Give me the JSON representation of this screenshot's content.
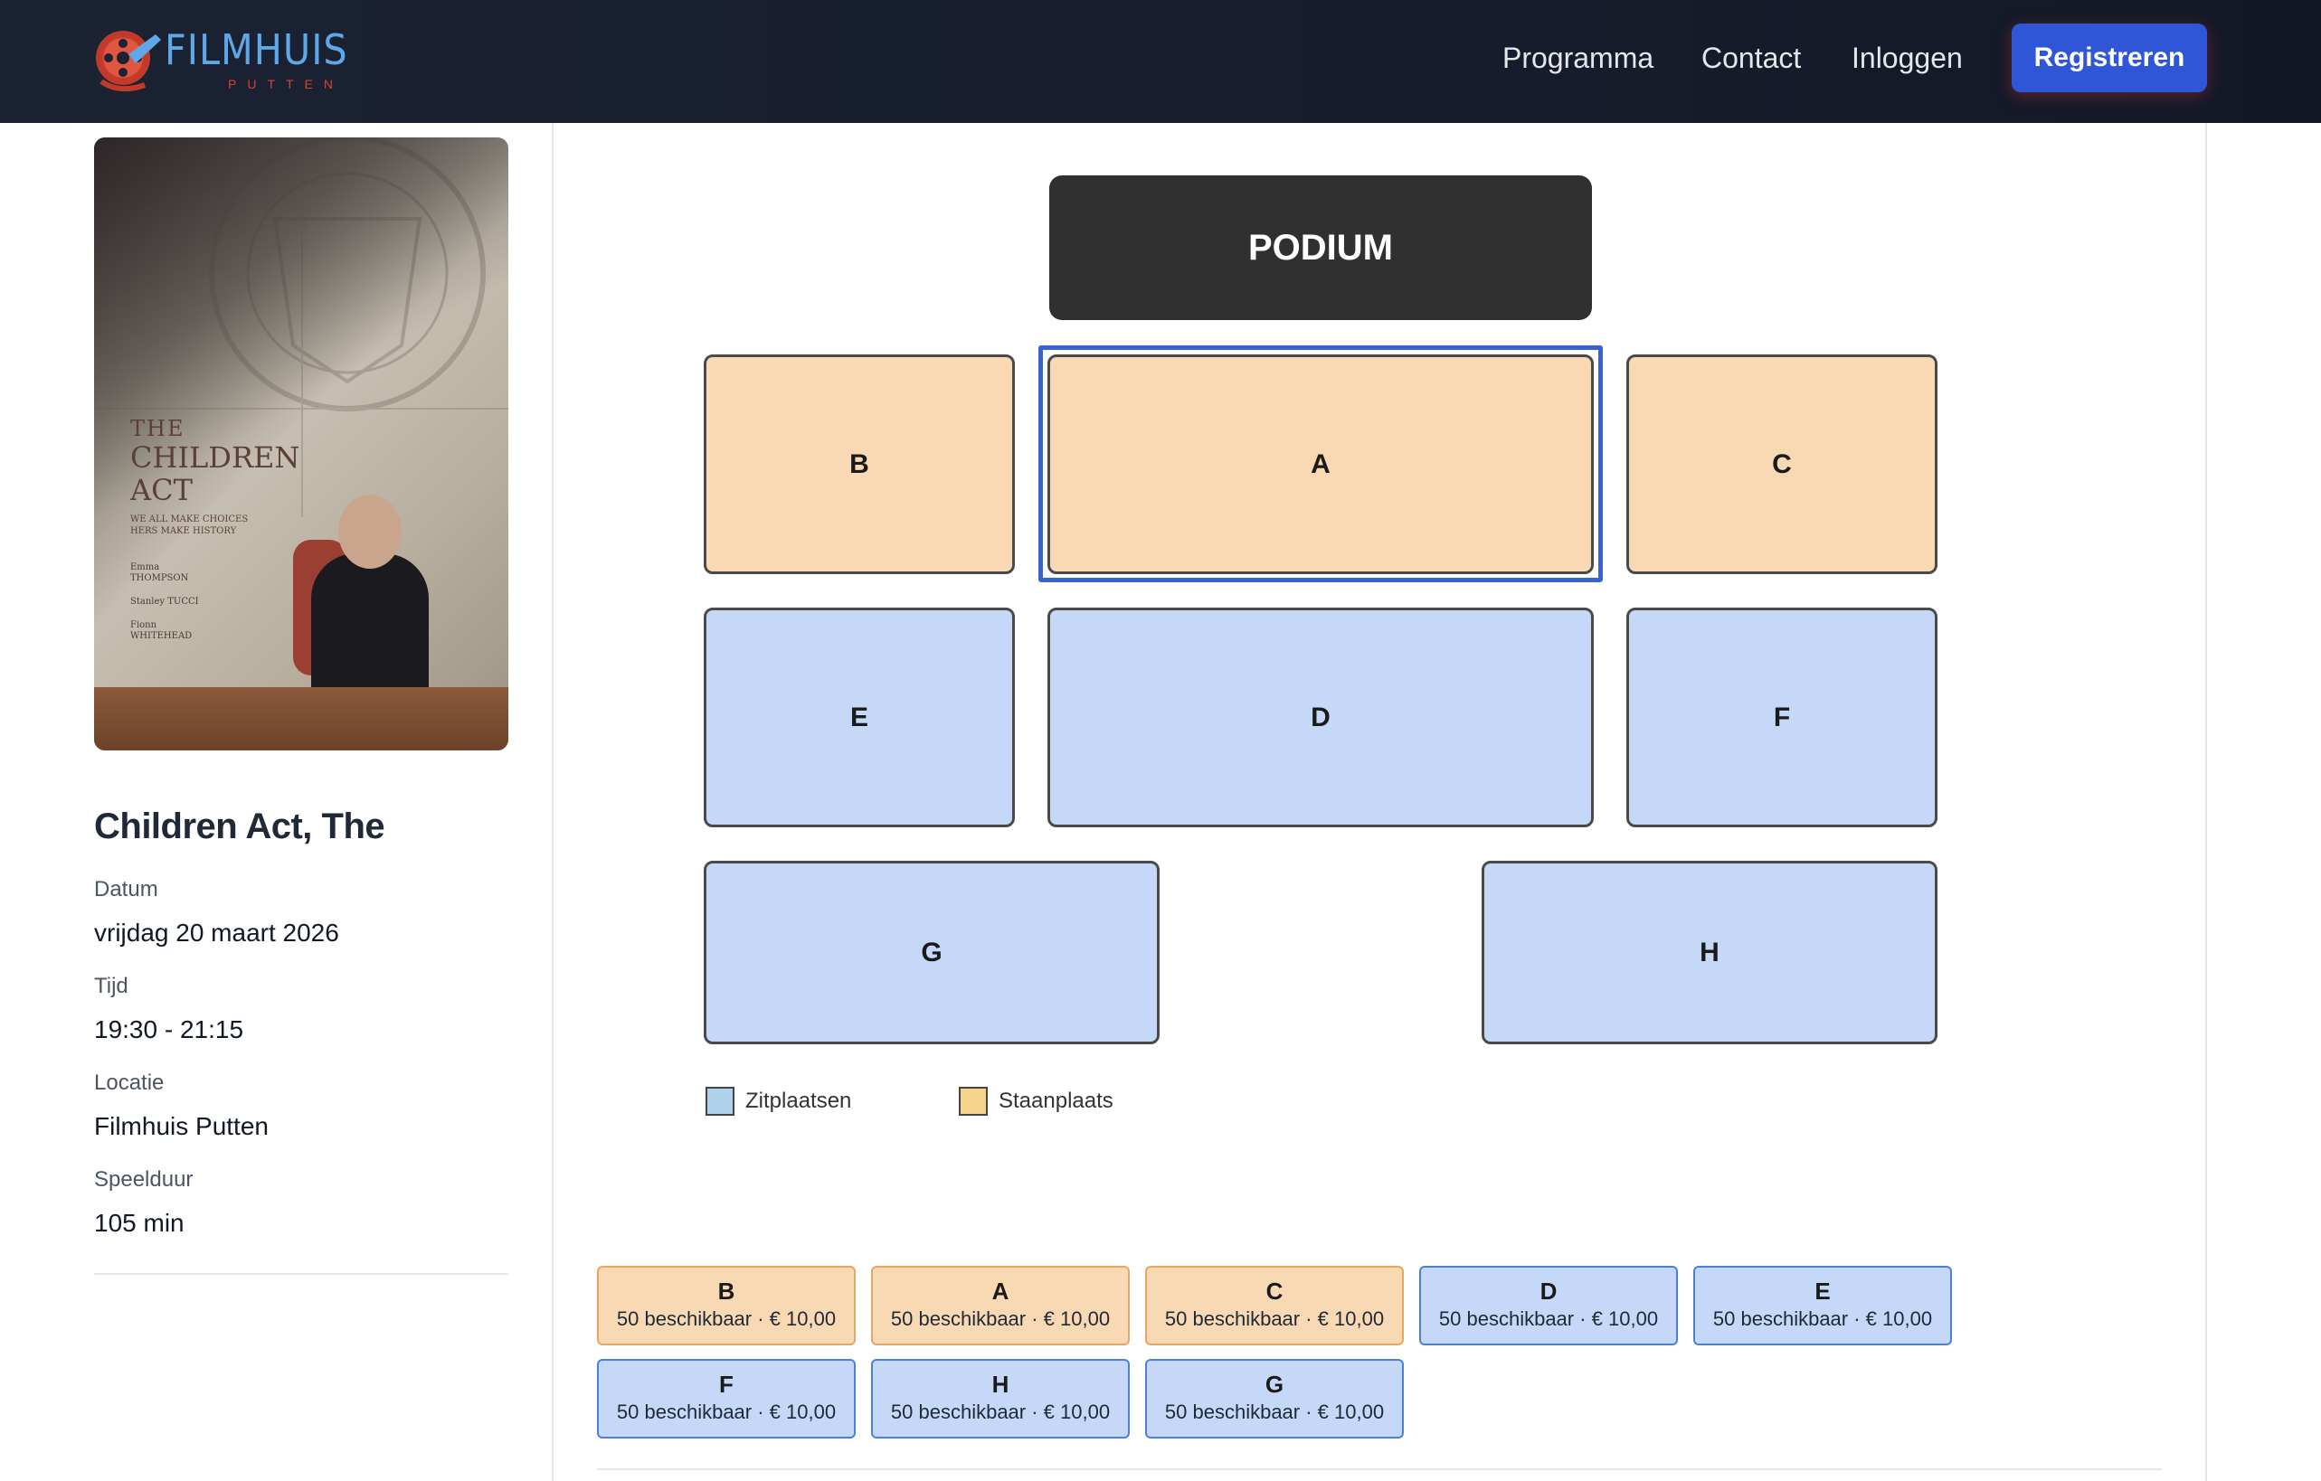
{
  "header": {
    "logo_main": "FILMHUIS",
    "logo_sub": "PUTTEN",
    "nav": [
      "Programma",
      "Contact",
      "Inloggen"
    ],
    "register_label": "Registreren"
  },
  "film": {
    "poster": {
      "title_the": "THE",
      "title_children": "CHILDREN",
      "title_act": "ACT",
      "tagline": "WE ALL MAKE CHOICES HERS MAKE HISTORY",
      "cast": [
        "Emma THOMPSON",
        "Stanley TUCCI",
        "Fionn WHITEHEAD"
      ]
    },
    "title": "Children Act, The",
    "date_label": "Datum",
    "date_value": "vrijdag 20 maart 2026",
    "time_label": "Tijd",
    "time_value": "19:30 - 21:15",
    "location_label": "Locatie",
    "location_value": "Filmhuis Putten",
    "duration_label": "Speelduur",
    "duration_value": "105 min"
  },
  "seatmap": {
    "podium": "PODIUM",
    "sections": {
      "A": "A",
      "B": "B",
      "C": "C",
      "D": "D",
      "E": "E",
      "F": "F",
      "G": "G",
      "H": "H"
    },
    "selected": "A",
    "legend": {
      "seated": "Zitplaatsen",
      "standing": "Staanplaats"
    },
    "colors": {
      "standing": "#f8d9b3",
      "seated": "#c5d8f7",
      "selected_outline": "#3a63d0",
      "podium": "#303030"
    }
  },
  "tickets": [
    {
      "name": "B",
      "info": "50 beschikbaar · € 10,00",
      "kind": "standing"
    },
    {
      "name": "A",
      "info": "50 beschikbaar · € 10,00",
      "kind": "standing"
    },
    {
      "name": "C",
      "info": "50 beschikbaar · € 10,00",
      "kind": "standing"
    },
    {
      "name": "D",
      "info": "50 beschikbaar · € 10,00",
      "kind": "seated"
    },
    {
      "name": "E",
      "info": "50 beschikbaar · € 10,00",
      "kind": "seated"
    },
    {
      "name": "F",
      "info": "50 beschikbaar · € 10,00",
      "kind": "seated"
    },
    {
      "name": "H",
      "info": "50 beschikbaar · € 10,00",
      "kind": "seated"
    },
    {
      "name": "G",
      "info": "50 beschikbaar · € 10,00",
      "kind": "seated"
    }
  ]
}
